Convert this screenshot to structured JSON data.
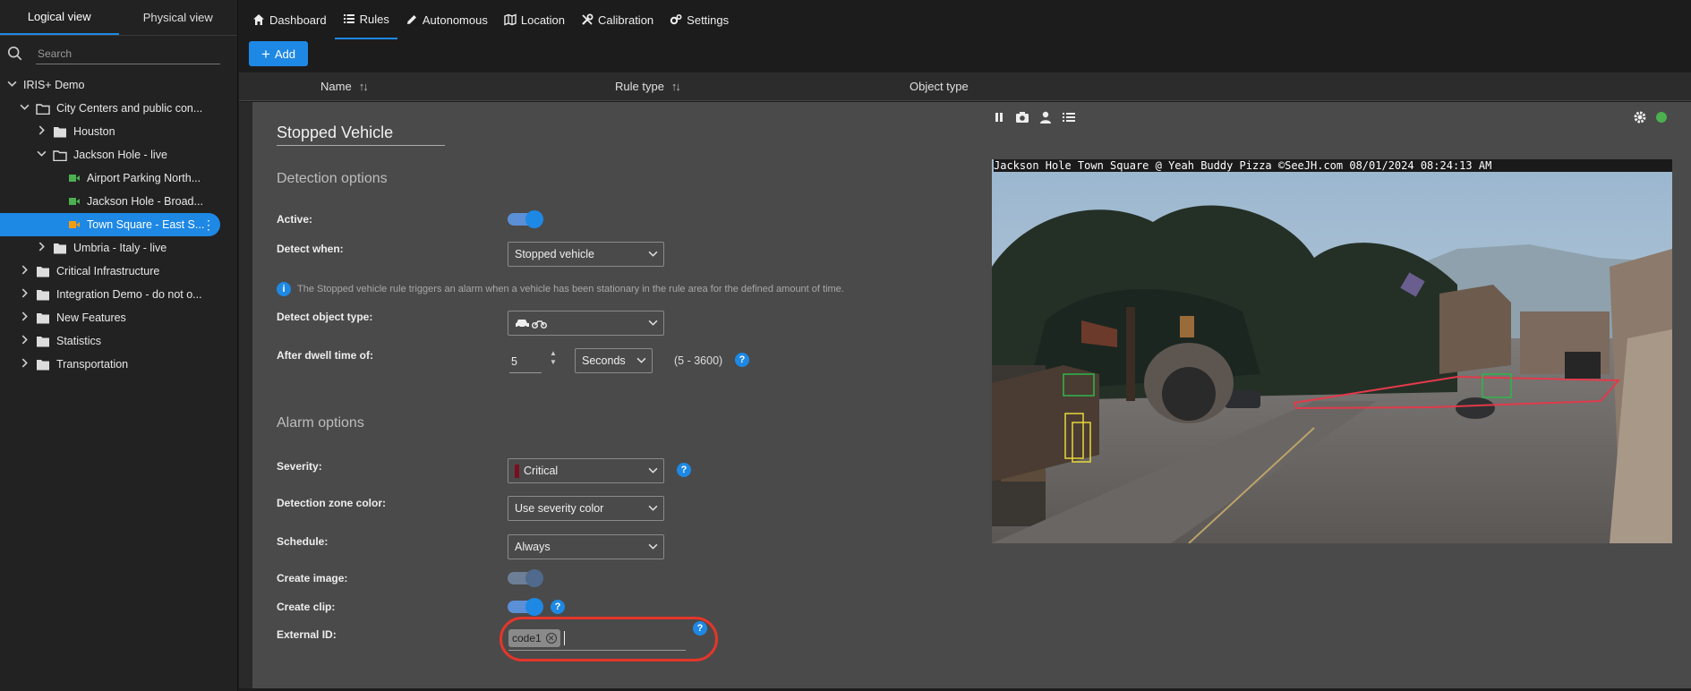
{
  "sidebar": {
    "tabs": [
      {
        "label": "Logical view",
        "active": true
      },
      {
        "label": "Physical view",
        "active": false
      }
    ],
    "search_placeholder": "Search",
    "tree": [
      {
        "label": "IRIS+ Demo"
      },
      {
        "label": "City Centers and public con..."
      },
      {
        "label": "Houston"
      },
      {
        "label": "Jackson Hole - live"
      },
      {
        "label": "Airport Parking North..."
      },
      {
        "label": "Jackson Hole - Broad..."
      },
      {
        "label": "Town Square - East S..."
      },
      {
        "label": "Umbria - Italy - live"
      },
      {
        "label": "Critical Infrastructure"
      },
      {
        "label": "Integration Demo - do not o..."
      },
      {
        "label": "New Features"
      },
      {
        "label": "Statistics"
      },
      {
        "label": "Transportation"
      }
    ]
  },
  "nav": {
    "items": [
      {
        "label": "Dashboard",
        "icon": "home-icon"
      },
      {
        "label": "Rules",
        "icon": "list-icon"
      },
      {
        "label": "Autonomous",
        "icon": "pencil-icon"
      },
      {
        "label": "Location",
        "icon": "map-icon"
      },
      {
        "label": "Calibration",
        "icon": "tools-icon"
      },
      {
        "label": "Settings",
        "icon": "gears-icon"
      }
    ],
    "active": "Rules"
  },
  "toolbar": {
    "add_label": "Add"
  },
  "table": {
    "columns": [
      "Name",
      "Rule type",
      "Object type"
    ]
  },
  "rule": {
    "name": "Stopped Vehicle",
    "detection_title": "Detection options",
    "active_label": "Active:",
    "detect_when_label": "Detect when:",
    "detect_when_value": "Stopped vehicle",
    "info_note": "The Stopped vehicle rule triggers an alarm when a vehicle has been stationary in the rule area for the defined amount of time.",
    "object_type_label": "Detect object type:",
    "dwell_label": "After dwell time of:",
    "dwell_value": "5",
    "dwell_unit": "Seconds",
    "dwell_range": "(5 - 3600)",
    "alarm_title": "Alarm options",
    "severity_label": "Severity:",
    "severity_value": "Critical",
    "zone_color_label": "Detection zone color:",
    "zone_color_value": "Use severity color",
    "schedule_label": "Schedule:",
    "schedule_value": "Always",
    "create_image_label": "Create image:",
    "create_clip_label": "Create clip:",
    "external_id_label": "External ID:",
    "external_id_chip": "code1",
    "help": "?",
    "info": "i"
  },
  "camera": {
    "osd_text": "Jackson Hole Town Square @ Yeah Buddy Pizza ©SeeJH.com 08/01/2024 08:24:13 AM",
    "status_color": "#4caf50"
  },
  "colors": {
    "accent": "#1e88e5",
    "critical": "#7a0e1e",
    "highlight_ring": "#e5352b"
  }
}
